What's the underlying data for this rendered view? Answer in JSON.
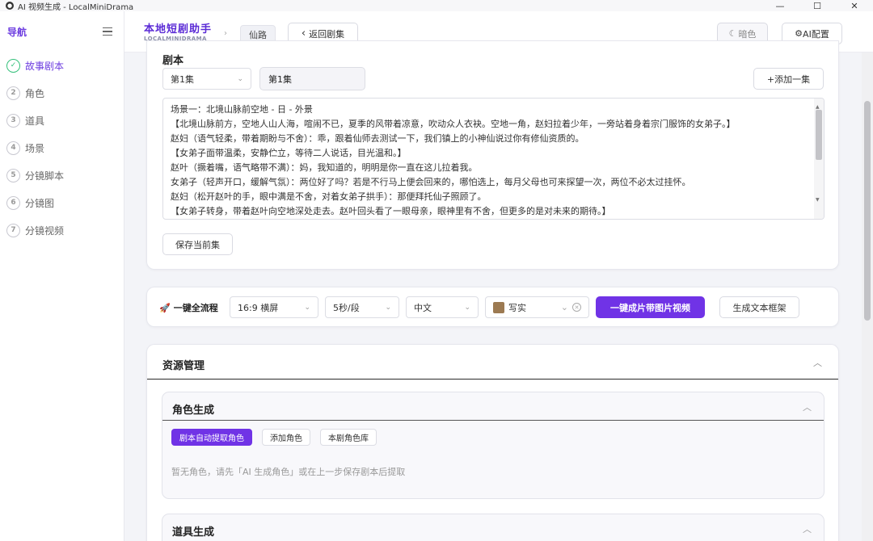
{
  "window": {
    "title": "AI 视频生成 - LocalMiniDrama",
    "controls": {
      "minimize": "—",
      "maximize": "☐",
      "close": "✕"
    }
  },
  "sidebar": {
    "title": "导航",
    "steps": [
      {
        "num": "✓",
        "label": "故事剧本",
        "state": "done"
      },
      {
        "num": "2",
        "label": "角色"
      },
      {
        "num": "3",
        "label": "道具"
      },
      {
        "num": "4",
        "label": "场景"
      },
      {
        "num": "5",
        "label": "分镜脚本"
      },
      {
        "num": "6",
        "label": "分镜图"
      },
      {
        "num": "7",
        "label": "分镜视频"
      }
    ]
  },
  "header": {
    "brand_cn": "本地短剧助手",
    "brand_en": "LOCALMINIDRAMA",
    "crumb_sep": "›",
    "project_chip": "仙路",
    "back_label": "返回剧集",
    "back_icon": "‹",
    "theme_label": "暗色",
    "theme_icon": "☾",
    "ai_label": "AI配置",
    "ai_icon": "⚙"
  },
  "script": {
    "section_title": "剧本",
    "episode_select": "第1集",
    "episode_name": "第1集",
    "add_episode": "+添加一集",
    "lines": [
      "场景一：北境山脉前空地 - 日 - 外景",
      "【北境山脉前方，空地人山人海，喧闹不已，夏季的风带着凉意，吹动众人衣袂。空地一角，赵妇拉着少年，一旁站着身着宗门服饰的女弟子。】",
      "赵妇（语气轻柔，带着期盼与不舍）：乖，跟着仙师去测试一下，我们镇上的小神仙说过你有修仙资质的。",
      "【女弟子面带温柔，安静伫立，等待二人说话，目光温和。】",
      "赵叶（撅着嘴，语气略带不满）：妈，我知道的，明明是你一直在这儿拉着我。",
      "女弟子（轻声开口，缓解气氛）：两位好了吗？若是不行马上便会回来的，哪怕选上，每月父母也可来探望一次，两位不必太过挂怀。",
      "赵妇（松开赵叶的手，眼中满是不舍，对着女弟子拱手）：那便拜托仙子照顾了。",
      "【女弟子转身，带着赵叶向空地深处走去。赵叶回头看了一眼母亲，眼神里有不舍，但更多的是对未来的期待。】"
    ],
    "save_label": "保存当前集"
  },
  "pipeline": {
    "label": "一键全流程",
    "ratio": "16:9 横屏",
    "duration": "5秒/段",
    "language": "中文",
    "style": "写实",
    "primary_label": "一键成片带图片视频",
    "frame_label": "生成文本框架"
  },
  "resources": {
    "title": "资源管理",
    "roles": {
      "title": "角色生成",
      "buttons": [
        "剧本自动提取角色",
        "添加角色",
        "本剧角色库"
      ],
      "empty": "暂无角色，请先「AI 生成角色」或在上一步保存剧本后提取"
    },
    "props": {
      "title": "道具生成"
    }
  },
  "colors": {
    "accent": "#7033e6",
    "done": "#34c07a",
    "brand": "#5b2bd6"
  }
}
